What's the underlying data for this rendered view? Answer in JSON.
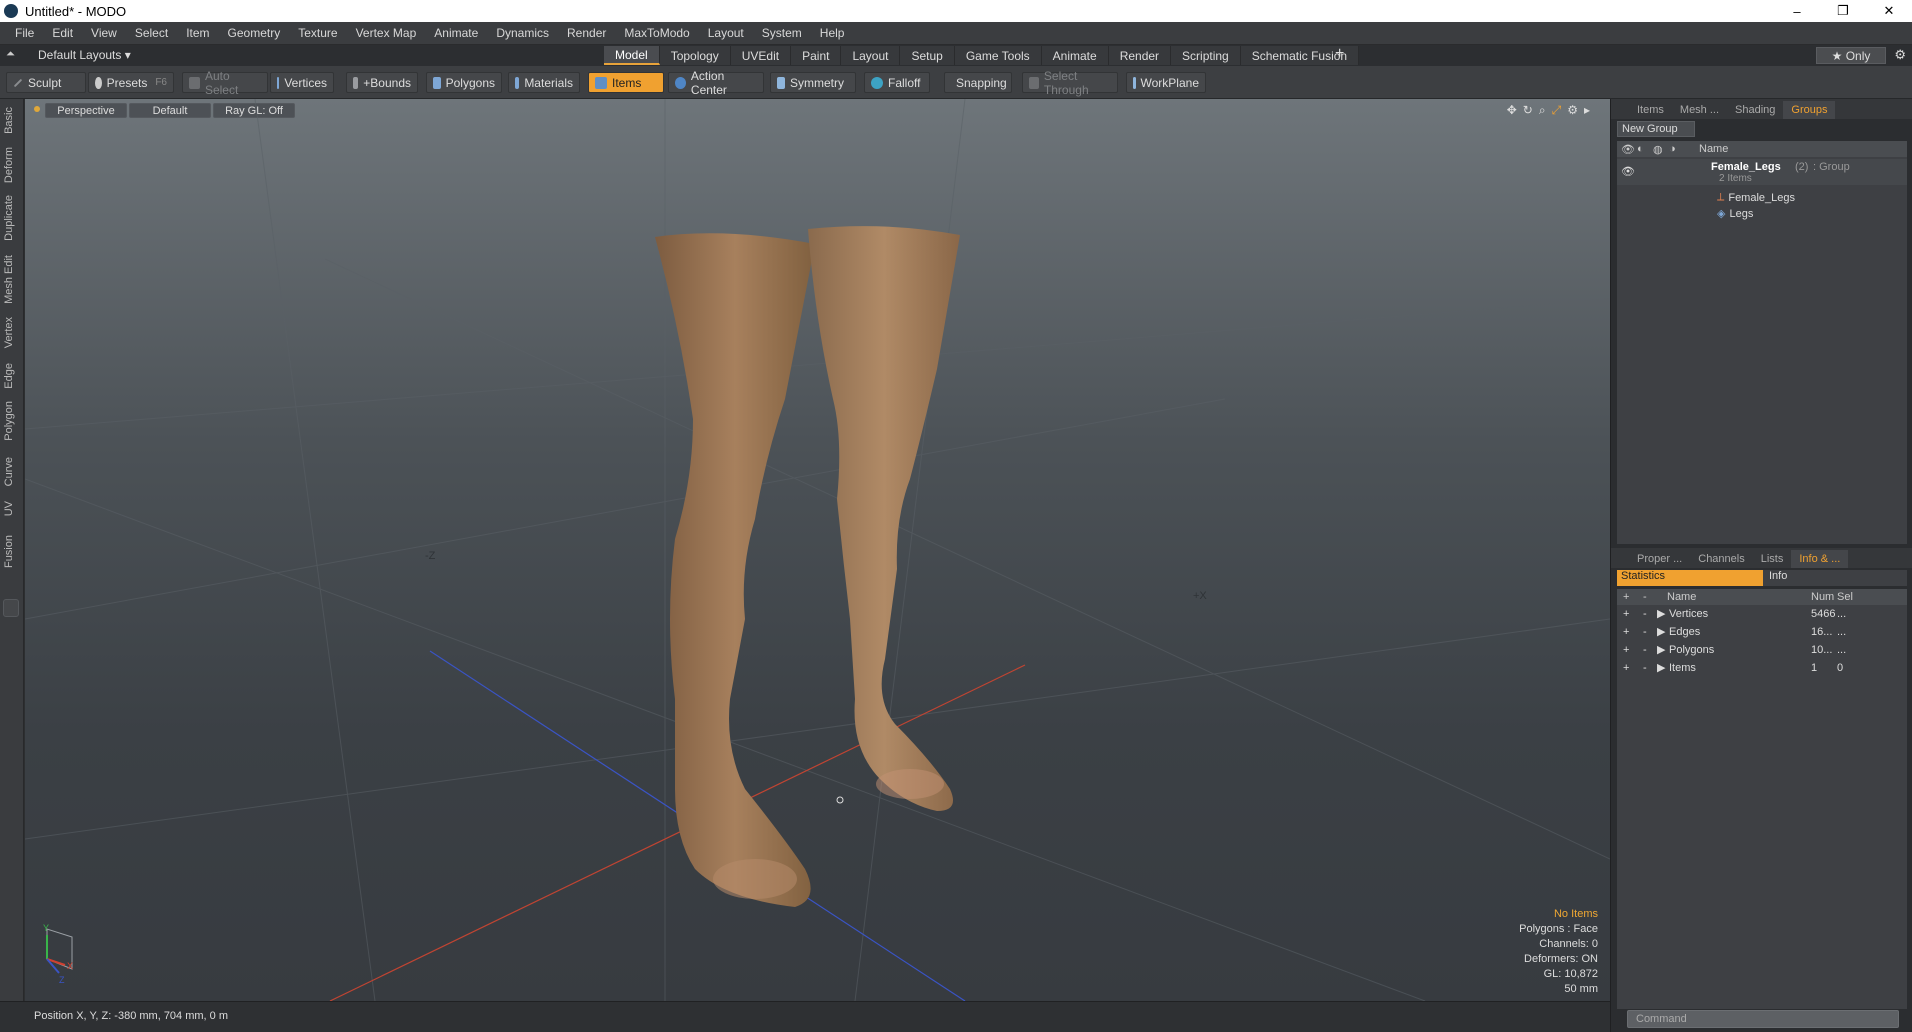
{
  "app": {
    "title": "Untitled* - MODO",
    "win_buttons": [
      "–",
      "❐",
      "✕"
    ]
  },
  "menu": [
    "File",
    "Edit",
    "View",
    "Select",
    "Item",
    "Geometry",
    "Texture",
    "Vertex Map",
    "Animate",
    "Dynamics",
    "Render",
    "MaxToModo",
    "Layout",
    "System",
    "Help"
  ],
  "layout": {
    "default_layouts": "Default Layouts ▾",
    "tabs": [
      "Model",
      "Topology",
      "UVEdit",
      "Paint",
      "Layout",
      "Setup",
      "Game Tools",
      "Animate",
      "Render",
      "Scripting",
      "Schematic Fusion"
    ],
    "active_tab": "Model",
    "plus": "+",
    "only": "★ Only"
  },
  "toolbar": {
    "sculpt": "Sculpt",
    "presets": "Presets",
    "presets_key": "F6",
    "auto_select": "Auto Select",
    "vertices": "Vertices",
    "bounds": "+Bounds",
    "polygons": "Polygons",
    "materials": "Materials",
    "items": "Items",
    "action_center": "Action Center",
    "symmetry": "Symmetry",
    "falloff": "Falloff",
    "snapping": "Snapping",
    "select_through": "Select Through",
    "workplane": "WorkPlane"
  },
  "left_tabs": [
    "Basic",
    "Deform",
    "Duplicate",
    "Mesh Edit",
    "Vertex",
    "Edge",
    "Polygon",
    "Curve",
    "UV",
    "Fusion"
  ],
  "viewport": {
    "perspective": "Perspective",
    "default": "Default",
    "raygl": "Ray GL: Off",
    "axis_minus_z": "-Z",
    "axis_plus_x": "+X",
    "axis_y": "Y",
    "axis_x": "X",
    "axis_z": "Z",
    "overlay": {
      "no_items": "No Items",
      "polygons": "Polygons : Face",
      "channels": "Channels: 0",
      "deformers": "Deformers: ON",
      "gl": "GL: 10,872",
      "lens": "50 mm"
    }
  },
  "status": {
    "position": "Position X, Y, Z:  -380 mm, 704 mm, 0 m"
  },
  "groups_panel": {
    "tabs": [
      "Items",
      "Mesh ...",
      "Shading",
      "Groups"
    ],
    "active": "Groups",
    "new_group": "New Group",
    "col_name": "Name",
    "group": {
      "name": "Female_Legs",
      "count": "(2)",
      "type": ": Group",
      "items": "2 Items"
    },
    "children": [
      "Female_Legs",
      "Legs"
    ]
  },
  "info_panel": {
    "tabs": [
      "Proper ...",
      "Channels",
      "Lists",
      "Info & ..."
    ],
    "active": "Info & ...",
    "sub_tabs": [
      "Statistics",
      "Info"
    ],
    "columns": [
      "Name",
      "Num",
      "Sel"
    ],
    "rows": [
      {
        "name": "Vertices",
        "num": "5466",
        "sel": "..."
      },
      {
        "name": "Edges",
        "num": "16...",
        "sel": "..."
      },
      {
        "name": "Polygons",
        "num": "10...",
        "sel": "..."
      },
      {
        "name": "Items",
        "num": "1",
        "sel": "0"
      }
    ]
  },
  "command": {
    "placeholder": "Command"
  }
}
